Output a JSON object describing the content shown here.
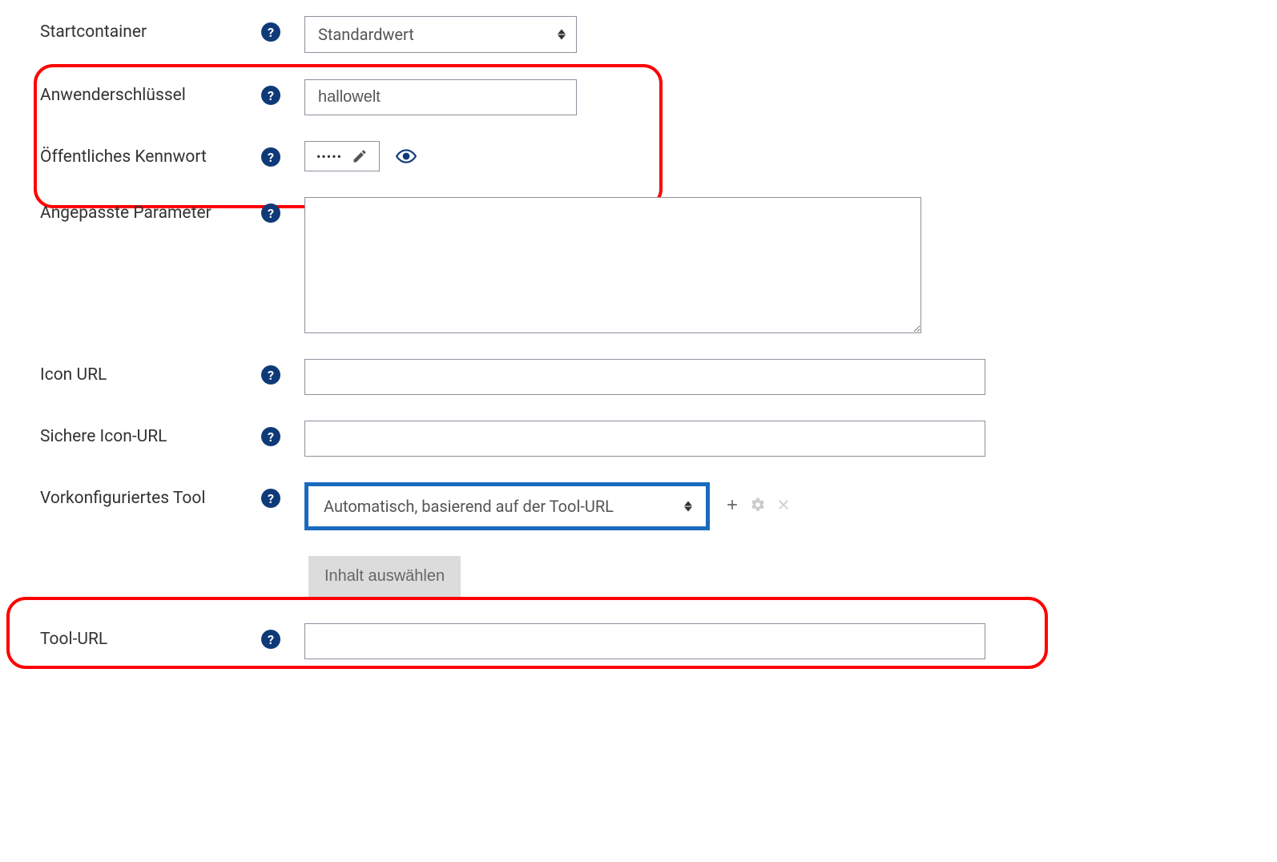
{
  "rows": {
    "startcontainer": {
      "label": "Startcontainer",
      "value": "Standardwert"
    },
    "anwenderschluessel": {
      "label": "Anwenderschlüssel",
      "value": "hallowelt"
    },
    "oeffentliches_kennwort": {
      "label": "Öffentliches Kennwort",
      "masked": "•••••"
    },
    "angepasste_parameter": {
      "label": "Angepasste Parameter",
      "value": ""
    },
    "icon_url": {
      "label": "Icon URL",
      "value": ""
    },
    "sichere_icon_url": {
      "label": "Sichere Icon-URL",
      "value": ""
    },
    "vorkonfiguriertes_tool": {
      "label": "Vorkonfiguriertes Tool",
      "value": "Automatisch, basierend auf der Tool-URL"
    },
    "inhalt_auswaehlen": {
      "label": "Inhalt auswählen"
    },
    "tool_url": {
      "label": "Tool-URL",
      "value": ""
    }
  }
}
